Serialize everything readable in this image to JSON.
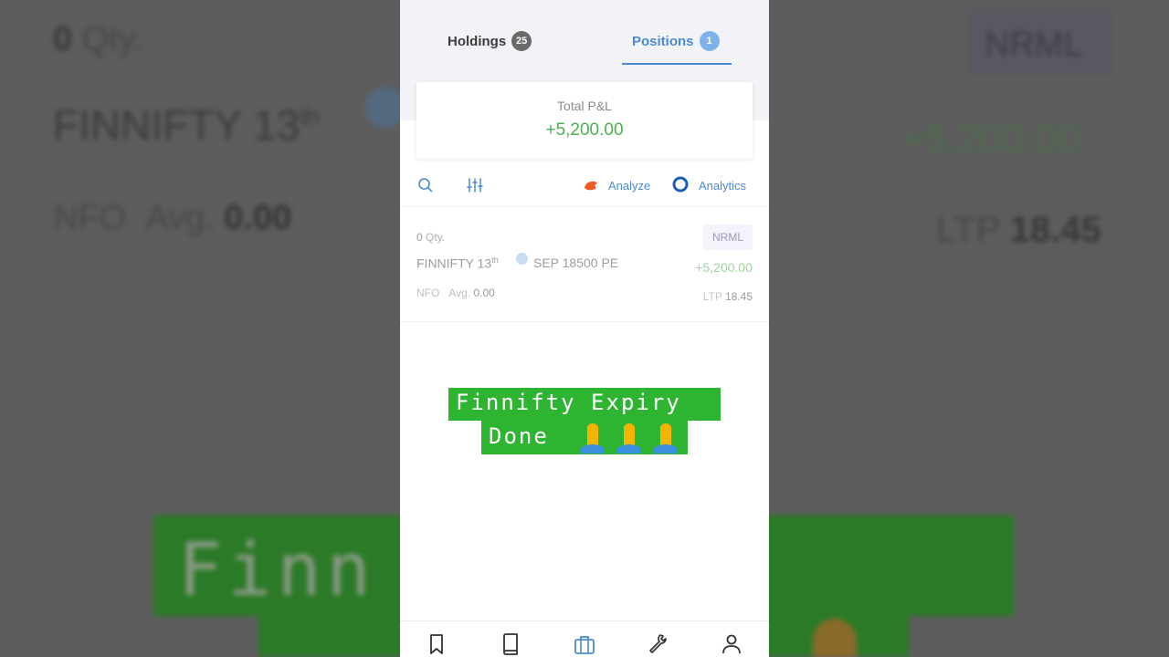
{
  "background": {
    "qty": "0",
    "qty_unit": "Qty.",
    "symbol": "FINNIFTY 13",
    "symbol_sup": "th",
    "exchange": "NFO",
    "avg_label": "Avg.",
    "avg_value": "0.00",
    "product": "NRML",
    "pnl": "+5,200.00",
    "ltp_label": "LTP",
    "ltp_value": "18.45",
    "banner_text": "Finn                 piry"
  },
  "tabs": {
    "holdings": {
      "label": "Holdings",
      "count": "25"
    },
    "positions": {
      "label": "Positions",
      "count": "1",
      "active": true
    }
  },
  "summary": {
    "label": "Total P&L",
    "value": "+5,200.00"
  },
  "toolbar": {
    "search_icon": "search-icon",
    "filter_icon": "sliders-icon",
    "analyze_label": "Analyze",
    "analytics_label": "Analytics"
  },
  "position": {
    "qty": "0",
    "qty_unit": "Qty.",
    "product": "NRML",
    "symbol": "FINNIFTY 13",
    "symbol_sup": "th",
    "contract": "SEP 18500 PE",
    "pnl": "+5,200.00",
    "exchange": "NFO",
    "avg_label": "Avg.",
    "avg_value": "0.00",
    "ltp_label": "LTP",
    "ltp_value": "18.45"
  },
  "overlay": {
    "line1": "Finnifty Expiry",
    "line2": "Done"
  },
  "bottom_nav": [
    {
      "icon": "bookmark-icon"
    },
    {
      "icon": "book-icon"
    },
    {
      "icon": "briefcase-icon",
      "active": true
    },
    {
      "icon": "wrench-icon"
    },
    {
      "icon": "user-icon"
    }
  ],
  "colors": {
    "accent": "#4a8ad4",
    "profit": "#4caf50",
    "overlay_green": "#2db531",
    "analyze_orange": "#f15a22"
  }
}
